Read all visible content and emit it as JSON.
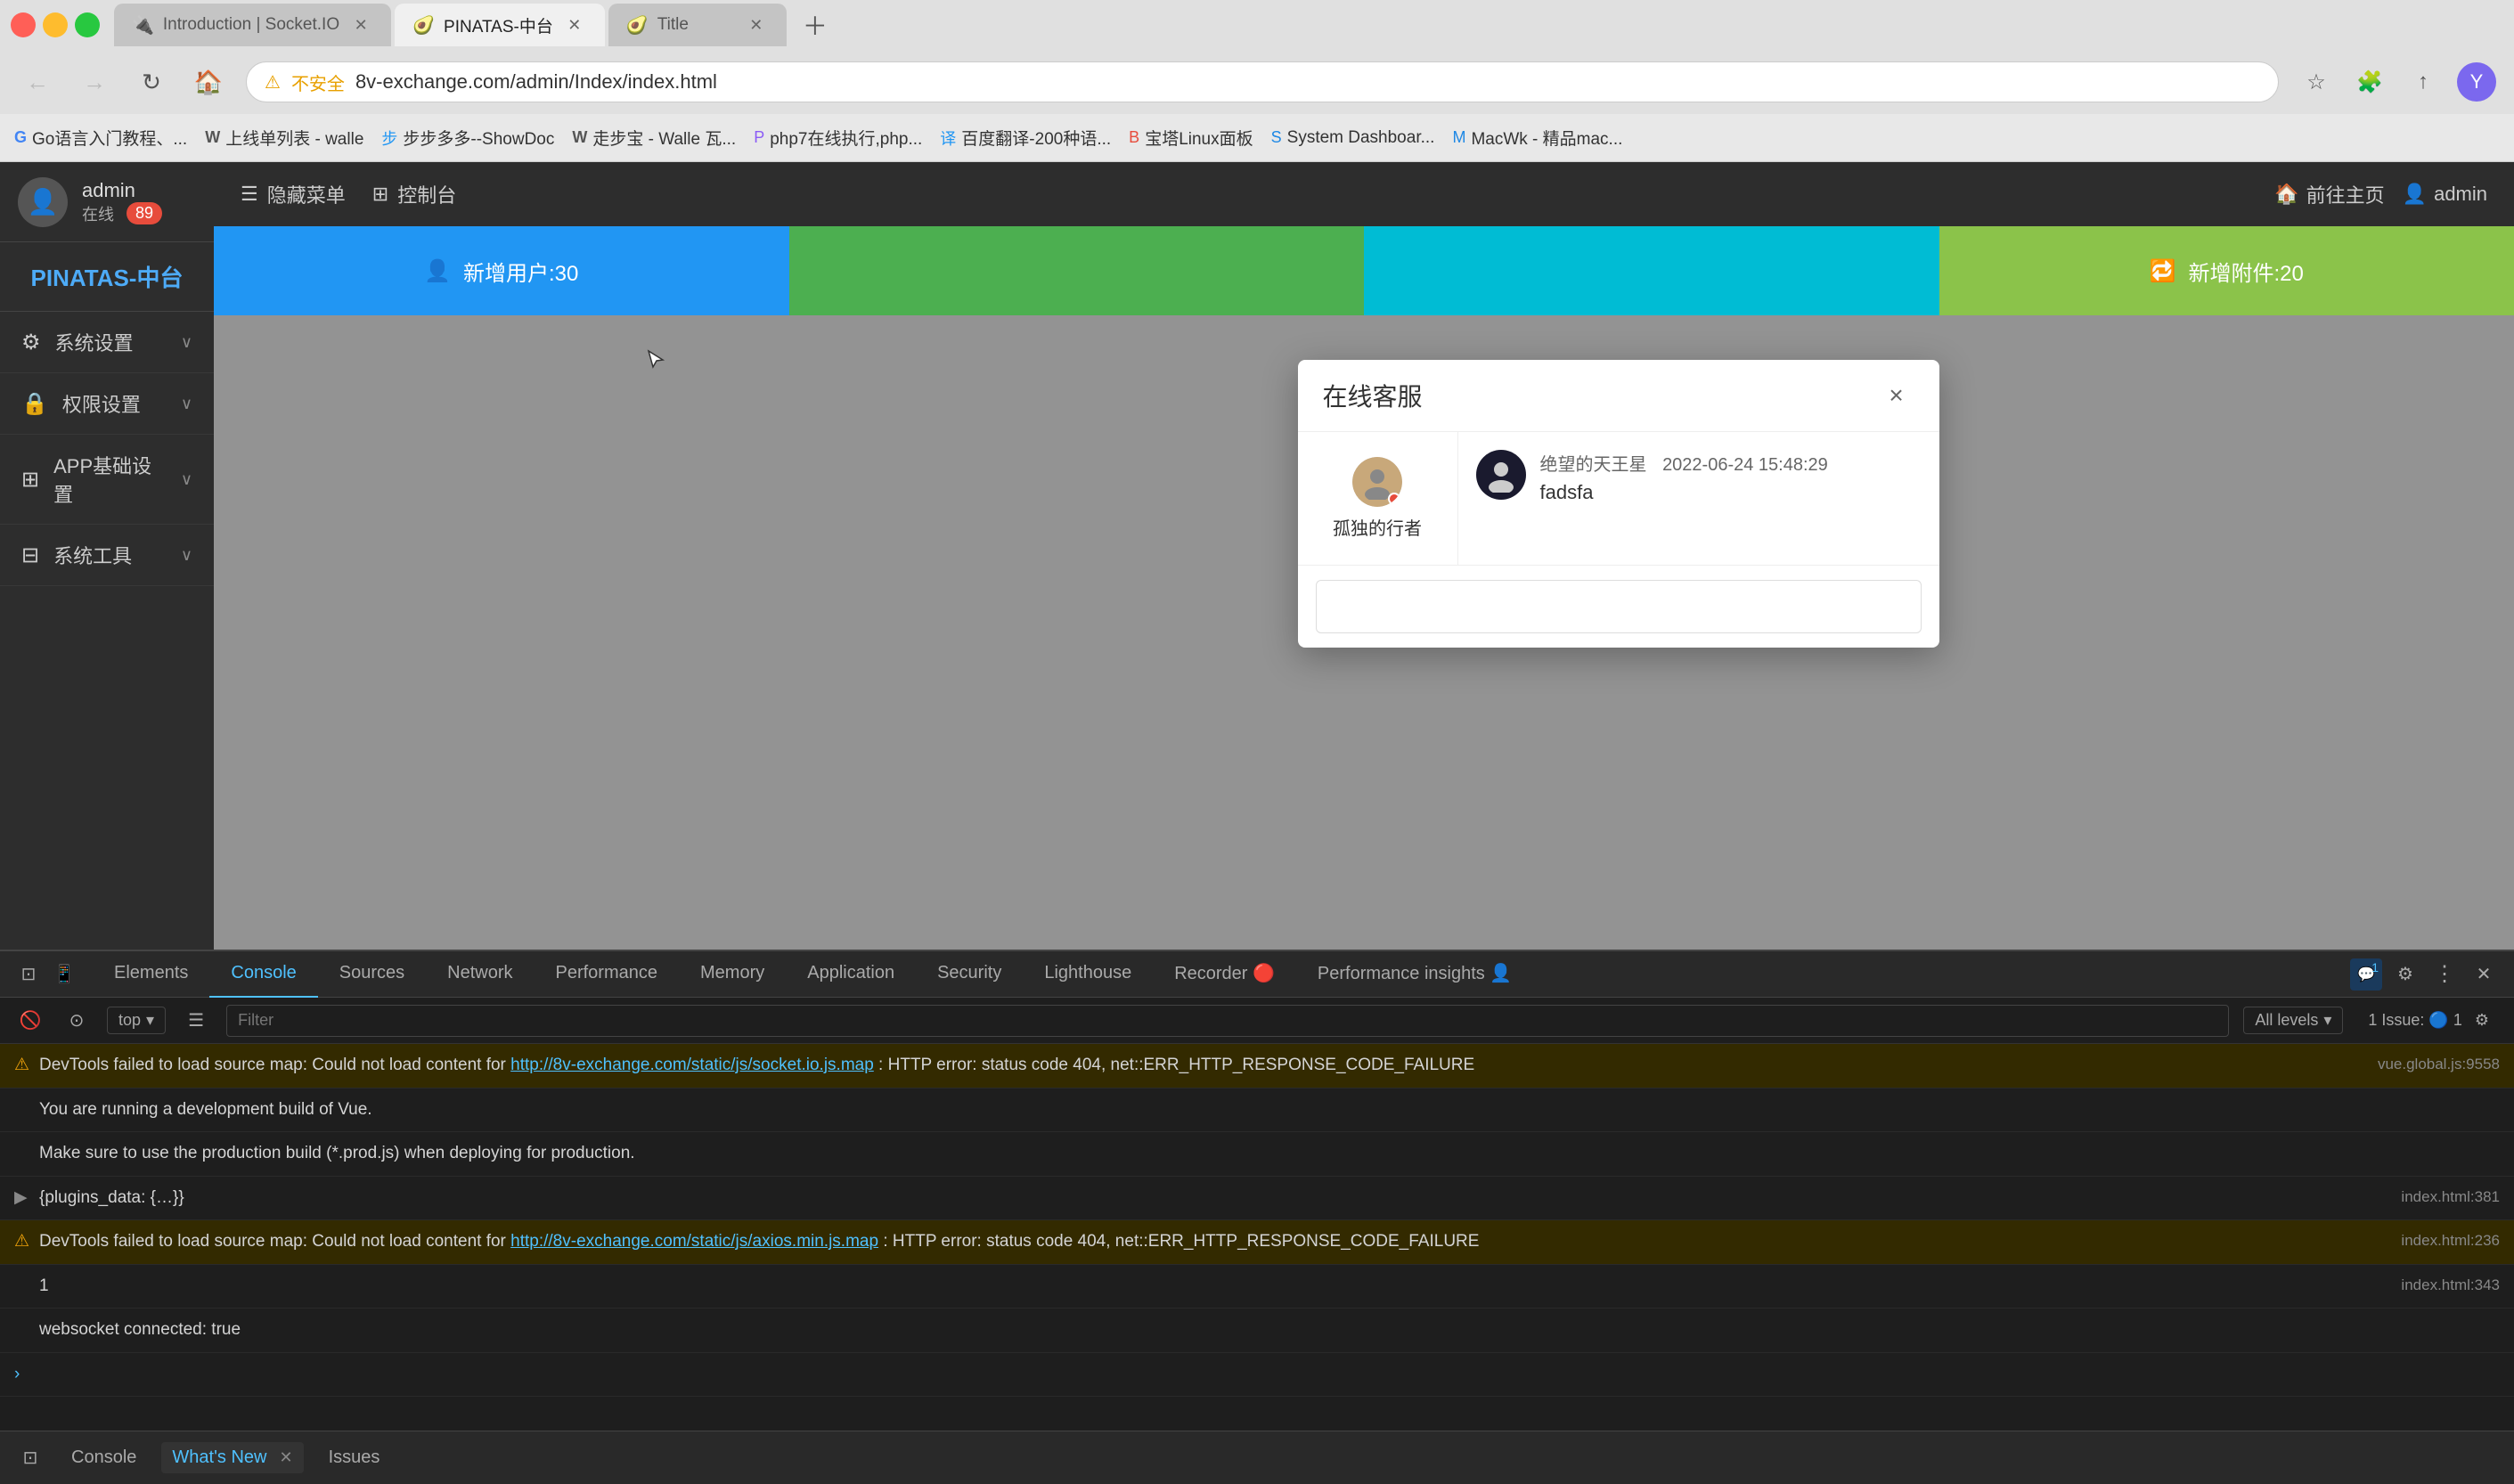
{
  "browser": {
    "tabs": [
      {
        "id": "tab1",
        "label": "Introduction | Socket.IO",
        "icon": "🔌",
        "active": false
      },
      {
        "id": "tab2",
        "label": "PINATAS-中台",
        "icon": "🥑",
        "active": true
      },
      {
        "id": "tab3",
        "label": "Title",
        "icon": "🥑",
        "active": false
      }
    ],
    "address": "8v-exchange.com/admin/Index/index.html",
    "security_label": "不安全"
  },
  "bookmarks": [
    {
      "label": "Go语言入门教程、...",
      "icon": "G"
    },
    {
      "label": "上线单列表 - walle",
      "icon": "W"
    },
    {
      "label": "步步多多--ShowDoc",
      "icon": "步"
    },
    {
      "label": "走步宝 - Walle 瓦...",
      "icon": "W"
    },
    {
      "label": "php7在线执行,php...",
      "icon": "P"
    },
    {
      "label": "百度翻译-200种语...",
      "icon": "译"
    },
    {
      "label": "宝塔Linux面板",
      "icon": "B"
    },
    {
      "label": "System Dashboar...",
      "icon": "S"
    },
    {
      "label": "MacWk - 精品mac...",
      "icon": "M"
    }
  ],
  "app_header": {
    "menu_label": "隐藏菜单",
    "console_label": "控制台",
    "home_label": "前往主页",
    "user_label": "admin"
  },
  "sidebar": {
    "brand": "PINATAS-中台",
    "admin": "admin",
    "status": "在线",
    "badge": "89",
    "menu_items": [
      {
        "id": "system-settings",
        "label": "系统设置",
        "icon": "⚙"
      },
      {
        "id": "permission-settings",
        "label": "权限设置",
        "icon": "🔒"
      },
      {
        "id": "app-basic-settings",
        "label": "APP基础设置",
        "icon": "⊞"
      },
      {
        "id": "system-tools",
        "label": "系统工具",
        "icon": "⊟"
      }
    ]
  },
  "dashboard_cards": [
    {
      "id": "new-users",
      "label": "新增用户:30",
      "icon": "👤",
      "color": "#2196F3"
    },
    {
      "id": "card2",
      "label": "",
      "icon": "",
      "color": "#4CAF50"
    },
    {
      "id": "card3",
      "label": "",
      "icon": "",
      "color": "#00BCD4"
    },
    {
      "id": "new-orders",
      "label": "新增附件:20",
      "icon": "🔁",
      "color": "#8BC34A"
    }
  ],
  "dialog": {
    "title": "在线客服",
    "close_label": "×",
    "users": [
      {
        "id": "lonely-traveler",
        "name": "孤独的行者",
        "online": true
      }
    ],
    "messages": [
      {
        "sender": "绝望的天王星",
        "time": "2022-06-24 15:48:29",
        "text": "fadsfa",
        "avatar_icon": "👤"
      }
    ],
    "input_placeholder": ""
  },
  "devtools": {
    "tabs": [
      {
        "id": "elements",
        "label": "Elements",
        "active": false
      },
      {
        "id": "console",
        "label": "Console",
        "active": true
      },
      {
        "id": "sources",
        "label": "Sources",
        "active": false
      },
      {
        "id": "network",
        "label": "Network",
        "active": false
      },
      {
        "id": "performance",
        "label": "Performance",
        "active": false
      },
      {
        "id": "memory",
        "label": "Memory",
        "active": false
      },
      {
        "id": "application",
        "label": "Application",
        "active": false
      },
      {
        "id": "security",
        "label": "Security",
        "active": false
      },
      {
        "id": "lighthouse",
        "label": "Lighthouse",
        "active": false
      },
      {
        "id": "recorder",
        "label": "Recorder 🔴",
        "active": false
      },
      {
        "id": "performance-insights",
        "label": "Performance insights 👤",
        "active": false
      }
    ],
    "toolbar": {
      "console_level": "top",
      "filter_placeholder": "Filter",
      "all_levels": "All levels",
      "issues_count": "1 Issue: 🔵 1"
    },
    "messages": [
      {
        "type": "warning",
        "text": "DevTools failed to load source map: Could not load content for ",
        "link": "http://8v-exchange.com/static/js/socket.io.js.map",
        "text2": ": HTTP error: status code 404, net::ERR_HTTP_RESPONSE_CODE_FAILURE",
        "location": "vue.global.js:9558"
      },
      {
        "type": "info",
        "text": "You are running a development build of Vue.",
        "location": ""
      },
      {
        "type": "info",
        "text": "Make sure to use the production build (*.prod.js) when deploying for production.",
        "location": ""
      },
      {
        "type": "expandable",
        "text": "▶ {plugins_data: {…}}",
        "location": "index.html:381"
      },
      {
        "type": "warning",
        "text": "DevTools failed to load source map: Could not load content for ",
        "link": "http://8v-exchange.com/static/js/axios.min.js.map",
        "text2": ": HTTP error: status code 404, net::ERR_HTTP_RESPONSE_CODE_FAILURE",
        "location": "index.html:236"
      },
      {
        "type": "info-plain",
        "text": "1",
        "location": "index.html:343"
      },
      {
        "type": "info-plain",
        "text": "websocket connected: true",
        "location": ""
      },
      {
        "type": "prompt",
        "text": ">",
        "location": ""
      }
    ],
    "bottom_tabs": [
      {
        "id": "console-bottom",
        "label": "Console",
        "active": false
      },
      {
        "id": "whats-new",
        "label": "What's New",
        "active": true,
        "closeable": true
      },
      {
        "id": "issues",
        "label": "Issues",
        "active": false
      }
    ]
  }
}
